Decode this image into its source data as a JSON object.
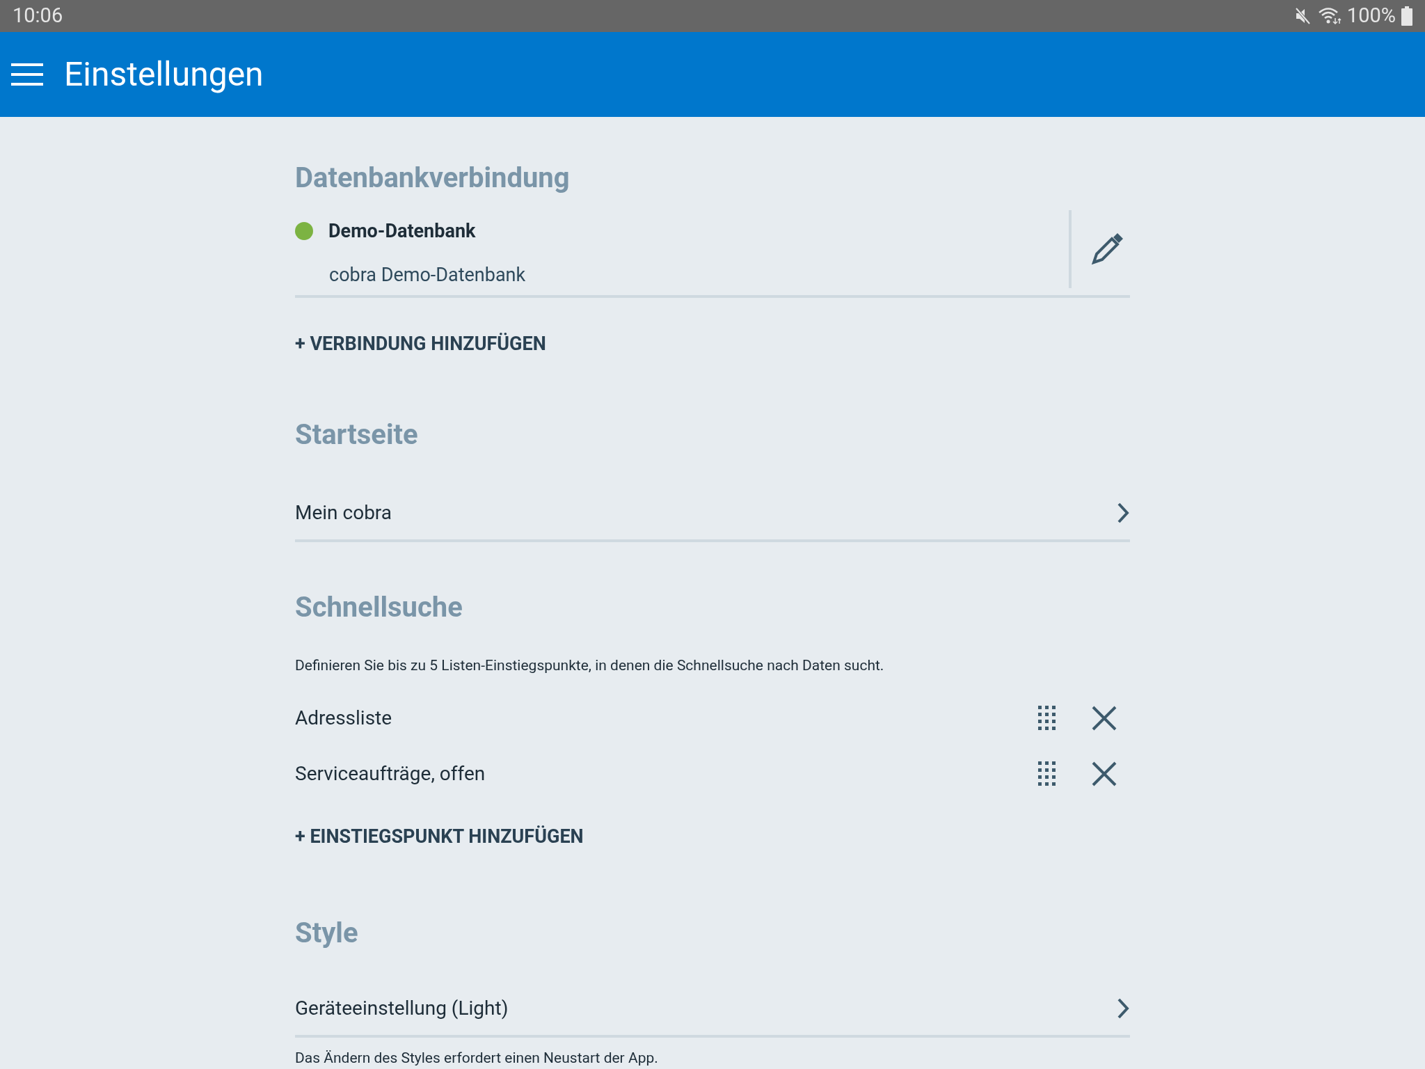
{
  "status_bar": {
    "time": "10:06",
    "battery": "100%"
  },
  "app_bar": {
    "title": "Einstellungen"
  },
  "database": {
    "heading": "Datenbankverbindung",
    "connections": [
      {
        "name": "Demo-Datenbank",
        "description": "cobra Demo-Datenbank",
        "color": "#7cb342"
      }
    ],
    "add_label": "+ VERBINDUNG HINZUFÜGEN"
  },
  "start_page": {
    "heading": "Startseite",
    "value": "Mein cobra"
  },
  "quick_search": {
    "heading": "Schnellsuche",
    "description": "Definieren Sie bis zu 5 Listen-Einstiegspunkte, in denen die Schnellsuche nach Daten sucht.",
    "entries": [
      "Adressliste",
      "Serviceaufträge, offen"
    ],
    "add_label": "+ EINSTIEGSPUNKT HINZUFÜGEN"
  },
  "style": {
    "heading": "Style",
    "value": "Geräteeinstellung (Light)",
    "note": "Das Ändern des Styles erfordert einen Neustart der App."
  }
}
